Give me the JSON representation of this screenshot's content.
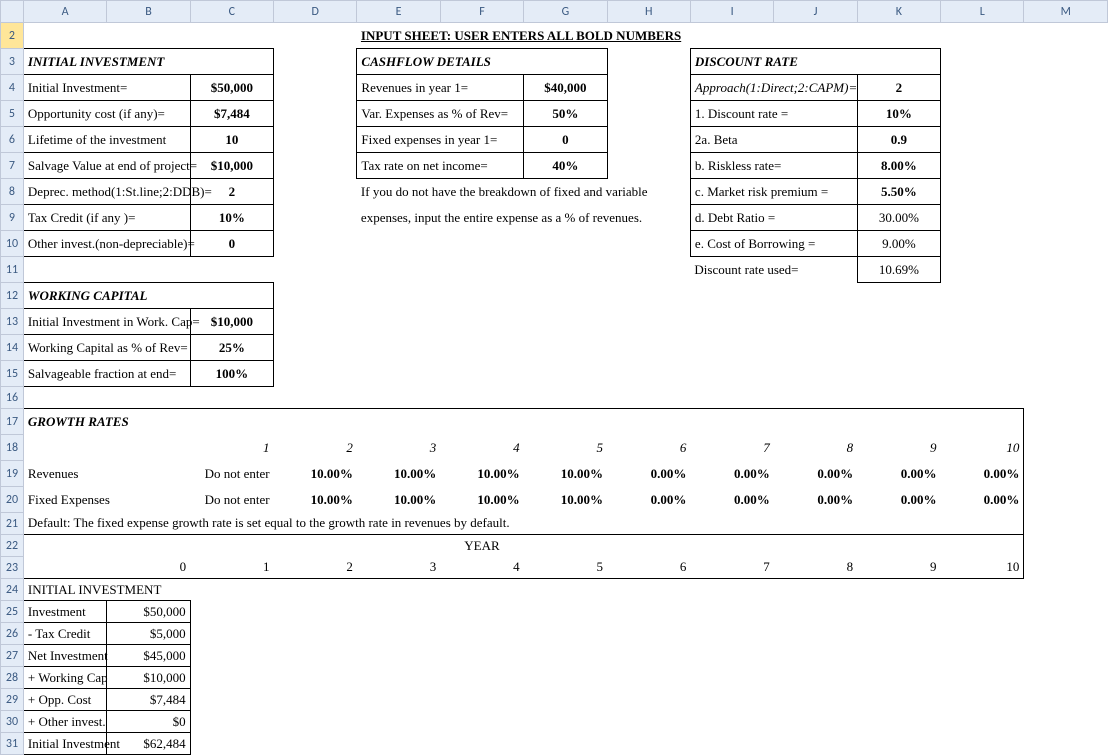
{
  "title": "INPUT SHEET: USER ENTERS ALL BOLD NUMBERS",
  "columns": [
    "A",
    "B",
    "C",
    "D",
    "E",
    "F",
    "G",
    "H",
    "I",
    "J",
    "K",
    "L",
    "M"
  ],
  "initial_investment": {
    "header": "INITIAL INVESTMENT",
    "r4l": "Initial Investment=",
    "r4v": "$50,000",
    "r5l": "Opportunity cost (if any)=",
    "r5v": "$7,484",
    "r6l": "Lifetime of the investment",
    "r6v": "10",
    "r7l": "Salvage Value at end of project=",
    "r7v": "$10,000",
    "r8l": "Deprec. method(1:St.line;2:DDB)=",
    "r8v": "2",
    "r9l": "Tax Credit (if any )=",
    "r9v": "10%",
    "r10l": "Other invest.(non-depreciable)=",
    "r10v": "0"
  },
  "cashflow": {
    "header": "CASHFLOW DETAILS",
    "r4l": "Revenues in  year 1=",
    "r4v": "$40,000",
    "r5l": "Var. Expenses as % of Rev=",
    "r5v": "50%",
    "r6l": "Fixed expenses in year 1=",
    "r6v": "0",
    "r7l": "Tax rate on net income=",
    "r7v": "40%",
    "note1": "If you do not have the breakdown of fixed and variable",
    "note2": "expenses, input the entire expense as a % of revenues."
  },
  "discount": {
    "header": "DISCOUNT RATE",
    "approach_l": "Approach(1:Direct;2:CAPM)=",
    "approach_v": "2",
    "r5l": "1. Discount rate =",
    "r5v": "10%",
    "r6l": "2a. Beta",
    "r6v": "0.9",
    "r7l": "b. Riskless rate=",
    "r7v": "8.00%",
    "r8l": "c. Market risk premium =",
    "r8v": "5.50%",
    "r9l": "d. Debt Ratio =",
    "r9v": "30.00%",
    "r10l": "e. Cost of Borrowing =",
    "r10v": "9.00%",
    "used_l": "Discount rate used=",
    "used_v": "10.69%"
  },
  "working_capital": {
    "header": "WORKING CAPITAL",
    "r13l": "Initial Investment in Work. Cap=",
    "r13v": "$10,000",
    "r14l": "Working Capital as % of Rev=",
    "r14v": "25%",
    "r15l": "Salvageable fraction at end=",
    "r15v": "100%"
  },
  "growth": {
    "header": "GROWTH RATES",
    "years": [
      "1",
      "2",
      "3",
      "4",
      "5",
      "6",
      "7",
      "8",
      "9",
      "10"
    ],
    "rev_label": "Revenues",
    "rev": [
      "Do not enter",
      "10.00%",
      "10.00%",
      "10.00%",
      "10.00%",
      "0.00%",
      "0.00%",
      "0.00%",
      "0.00%",
      "0.00%"
    ],
    "fx_label": "Fixed Expenses",
    "fx": [
      "Do not enter",
      "10.00%",
      "10.00%",
      "10.00%",
      "10.00%",
      "0.00%",
      "0.00%",
      "0.00%",
      "0.00%",
      "0.00%"
    ],
    "default_note": "Default: The fixed expense growth rate is set equal to the growth rate in revenues by default."
  },
  "year_header": "YEAR",
  "year_nums": [
    "0",
    "1",
    "2",
    "3",
    "4",
    "5",
    "6",
    "7",
    "8",
    "9",
    "10"
  ],
  "ii_section": {
    "title": "INITIAL INVESTMENT",
    "rows": [
      {
        "l": "Investment",
        "v": "$50,000"
      },
      {
        "l": " - Tax Credit",
        "v": "$5,000"
      },
      {
        "l": "Net Investment",
        "v": "$45,000"
      },
      {
        "l": " + Working Cap",
        "v": "$10,000"
      },
      {
        "l": " + Opp. Cost",
        "v": "$7,484"
      },
      {
        "l": " + Other invest.",
        "v": "$0"
      },
      {
        "l": "Initial Investment",
        "v": "$62,484"
      }
    ]
  }
}
